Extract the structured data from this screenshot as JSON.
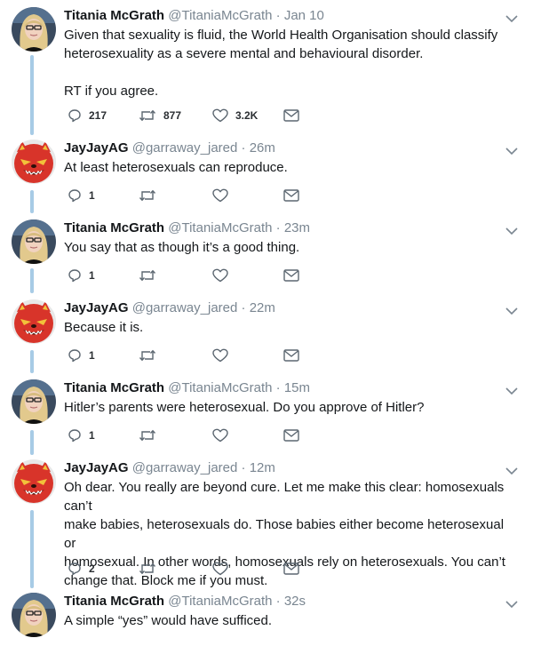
{
  "tweets": [
    {
      "name": "Titania McGrath",
      "handle": "@TitaniaMcGrath",
      "time": "Jan 10",
      "text": "Given that sexuality is fluid, the World Health Organisation should classify heterosexuality as a severe mental and behavioural disorder.\n\nRT if you agree.",
      "replies": "217",
      "retweets": "877",
      "likes": "3.2K",
      "avatar": "blonde-woman-avatar"
    },
    {
      "name": "JayJayAG",
      "handle": "@garraway_jared",
      "time": "26m",
      "text": "At least heterosexuals can reproduce.",
      "replies": "1",
      "retweets": "",
      "likes": "",
      "avatar": "red-fox-cartoon-avatar"
    },
    {
      "name": "Titania McGrath",
      "handle": "@TitaniaMcGrath",
      "time": "23m",
      "text": "You say that as though it’s a good thing.",
      "replies": "1",
      "retweets": "",
      "likes": "",
      "avatar": "blonde-woman-avatar"
    },
    {
      "name": "JayJayAG",
      "handle": "@garraway_jared",
      "time": "22m",
      "text": "Because it is.",
      "replies": "1",
      "retweets": "",
      "likes": "",
      "avatar": "red-fox-cartoon-avatar"
    },
    {
      "name": "Titania McGrath",
      "handle": "@TitaniaMcGrath",
      "time": "15m",
      "text": "Hitler’s parents were heterosexual. Do you approve of Hitler?",
      "replies": "1",
      "retweets": "",
      "likes": "",
      "avatar": "blonde-woman-avatar"
    },
    {
      "name": "JayJayAG",
      "handle": "@garraway_jared",
      "time": "12m",
      "text": "Oh dear. You really are beyond cure. Let me make this clear: homosexuals can’t\nmake babies, heterosexuals do. Those babies either become heterosexual or\nhomosexual. In other words, homosexuals rely on heterosexuals. You can’t\nchange that. Block me if you must.",
      "replies": "2",
      "retweets": "",
      "likes": "",
      "avatar": "red-fox-cartoon-avatar"
    },
    {
      "name": "Titania McGrath",
      "handle": "@TitaniaMcGrath",
      "time": "32s",
      "text": "A simple “yes” would have sufficed.",
      "replies": "",
      "retweets": "",
      "likes": "",
      "avatar": "blonde-woman-avatar"
    }
  ],
  "separator": "·",
  "colors": {
    "thread_line": "#a7cbe6",
    "handle_gray": "#7a8691",
    "icon_gray": "#5b6670"
  }
}
